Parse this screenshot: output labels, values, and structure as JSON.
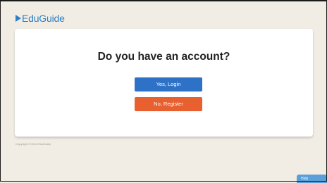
{
  "header": {
    "brand": "EduGuide"
  },
  "account_prompt": {
    "question": "Do you have an account?",
    "login_label": "Yes, Login",
    "register_label": "No, Register"
  },
  "footer": {
    "copyright": "Copyright © 2014 EduGuide"
  },
  "help": {
    "label": "Help"
  },
  "colors": {
    "brand": "#2f7fc7",
    "login_button": "#2e72c7",
    "register_button": "#e8602f",
    "page_background": "#f1ede4",
    "help_tab": "#5b9fd9"
  }
}
